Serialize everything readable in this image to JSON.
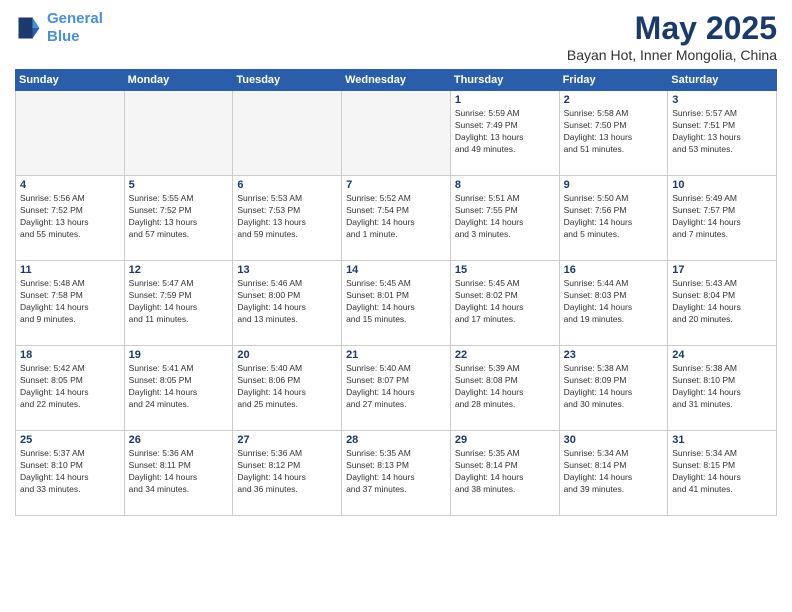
{
  "header": {
    "logo_line1": "General",
    "logo_line2": "Blue",
    "title": "May 2025",
    "location": "Bayan Hot, Inner Mongolia, China"
  },
  "days_of_week": [
    "Sunday",
    "Monday",
    "Tuesday",
    "Wednesday",
    "Thursday",
    "Friday",
    "Saturday"
  ],
  "weeks": [
    [
      {
        "day": "",
        "info": ""
      },
      {
        "day": "",
        "info": ""
      },
      {
        "day": "",
        "info": ""
      },
      {
        "day": "",
        "info": ""
      },
      {
        "day": "1",
        "info": "Sunrise: 5:59 AM\nSunset: 7:49 PM\nDaylight: 13 hours\nand 49 minutes."
      },
      {
        "day": "2",
        "info": "Sunrise: 5:58 AM\nSunset: 7:50 PM\nDaylight: 13 hours\nand 51 minutes."
      },
      {
        "day": "3",
        "info": "Sunrise: 5:57 AM\nSunset: 7:51 PM\nDaylight: 13 hours\nand 53 minutes."
      }
    ],
    [
      {
        "day": "4",
        "info": "Sunrise: 5:56 AM\nSunset: 7:52 PM\nDaylight: 13 hours\nand 55 minutes."
      },
      {
        "day": "5",
        "info": "Sunrise: 5:55 AM\nSunset: 7:52 PM\nDaylight: 13 hours\nand 57 minutes."
      },
      {
        "day": "6",
        "info": "Sunrise: 5:53 AM\nSunset: 7:53 PM\nDaylight: 13 hours\nand 59 minutes."
      },
      {
        "day": "7",
        "info": "Sunrise: 5:52 AM\nSunset: 7:54 PM\nDaylight: 14 hours\nand 1 minute."
      },
      {
        "day": "8",
        "info": "Sunrise: 5:51 AM\nSunset: 7:55 PM\nDaylight: 14 hours\nand 3 minutes."
      },
      {
        "day": "9",
        "info": "Sunrise: 5:50 AM\nSunset: 7:56 PM\nDaylight: 14 hours\nand 5 minutes."
      },
      {
        "day": "10",
        "info": "Sunrise: 5:49 AM\nSunset: 7:57 PM\nDaylight: 14 hours\nand 7 minutes."
      }
    ],
    [
      {
        "day": "11",
        "info": "Sunrise: 5:48 AM\nSunset: 7:58 PM\nDaylight: 14 hours\nand 9 minutes."
      },
      {
        "day": "12",
        "info": "Sunrise: 5:47 AM\nSunset: 7:59 PM\nDaylight: 14 hours\nand 11 minutes."
      },
      {
        "day": "13",
        "info": "Sunrise: 5:46 AM\nSunset: 8:00 PM\nDaylight: 14 hours\nand 13 minutes."
      },
      {
        "day": "14",
        "info": "Sunrise: 5:45 AM\nSunset: 8:01 PM\nDaylight: 14 hours\nand 15 minutes."
      },
      {
        "day": "15",
        "info": "Sunrise: 5:45 AM\nSunset: 8:02 PM\nDaylight: 14 hours\nand 17 minutes."
      },
      {
        "day": "16",
        "info": "Sunrise: 5:44 AM\nSunset: 8:03 PM\nDaylight: 14 hours\nand 19 minutes."
      },
      {
        "day": "17",
        "info": "Sunrise: 5:43 AM\nSunset: 8:04 PM\nDaylight: 14 hours\nand 20 minutes."
      }
    ],
    [
      {
        "day": "18",
        "info": "Sunrise: 5:42 AM\nSunset: 8:05 PM\nDaylight: 14 hours\nand 22 minutes."
      },
      {
        "day": "19",
        "info": "Sunrise: 5:41 AM\nSunset: 8:05 PM\nDaylight: 14 hours\nand 24 minutes."
      },
      {
        "day": "20",
        "info": "Sunrise: 5:40 AM\nSunset: 8:06 PM\nDaylight: 14 hours\nand 25 minutes."
      },
      {
        "day": "21",
        "info": "Sunrise: 5:40 AM\nSunset: 8:07 PM\nDaylight: 14 hours\nand 27 minutes."
      },
      {
        "day": "22",
        "info": "Sunrise: 5:39 AM\nSunset: 8:08 PM\nDaylight: 14 hours\nand 28 minutes."
      },
      {
        "day": "23",
        "info": "Sunrise: 5:38 AM\nSunset: 8:09 PM\nDaylight: 14 hours\nand 30 minutes."
      },
      {
        "day": "24",
        "info": "Sunrise: 5:38 AM\nSunset: 8:10 PM\nDaylight: 14 hours\nand 31 minutes."
      }
    ],
    [
      {
        "day": "25",
        "info": "Sunrise: 5:37 AM\nSunset: 8:10 PM\nDaylight: 14 hours\nand 33 minutes."
      },
      {
        "day": "26",
        "info": "Sunrise: 5:36 AM\nSunset: 8:11 PM\nDaylight: 14 hours\nand 34 minutes."
      },
      {
        "day": "27",
        "info": "Sunrise: 5:36 AM\nSunset: 8:12 PM\nDaylight: 14 hours\nand 36 minutes."
      },
      {
        "day": "28",
        "info": "Sunrise: 5:35 AM\nSunset: 8:13 PM\nDaylight: 14 hours\nand 37 minutes."
      },
      {
        "day": "29",
        "info": "Sunrise: 5:35 AM\nSunset: 8:14 PM\nDaylight: 14 hours\nand 38 minutes."
      },
      {
        "day": "30",
        "info": "Sunrise: 5:34 AM\nSunset: 8:14 PM\nDaylight: 14 hours\nand 39 minutes."
      },
      {
        "day": "31",
        "info": "Sunrise: 5:34 AM\nSunset: 8:15 PM\nDaylight: 14 hours\nand 41 minutes."
      }
    ]
  ]
}
